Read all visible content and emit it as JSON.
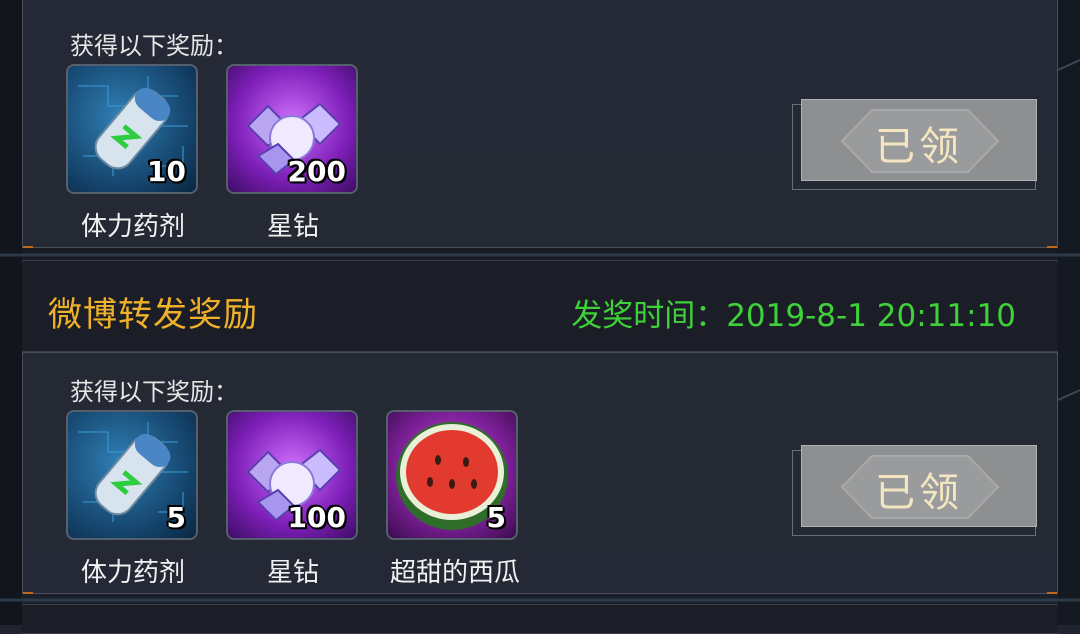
{
  "section1": {
    "reward_label": "获得以下奖励：",
    "items": [
      {
        "name": "体力药剂",
        "count": "10",
        "icon": "stamina-potion-icon"
      },
      {
        "name": "星钻",
        "count": "200",
        "icon": "star-diamond-icon"
      }
    ],
    "claim_label": "已领"
  },
  "section2": {
    "title": "微博转发奖励",
    "time": "发奖时间：2019-8-1 20:11:10",
    "reward_label": "获得以下奖励：",
    "items": [
      {
        "name": "体力药剂",
        "count": "5",
        "icon": "stamina-potion-icon"
      },
      {
        "name": "星钻",
        "count": "100",
        "icon": "star-diamond-icon"
      },
      {
        "name": "超甜的西瓜",
        "count": "5",
        "icon": "watermelon-icon"
      }
    ],
    "claim_label": "已领"
  },
  "colors": {
    "title": "#f0b12a",
    "time": "#3ed13a",
    "claimed_button": "#8e8f90"
  }
}
